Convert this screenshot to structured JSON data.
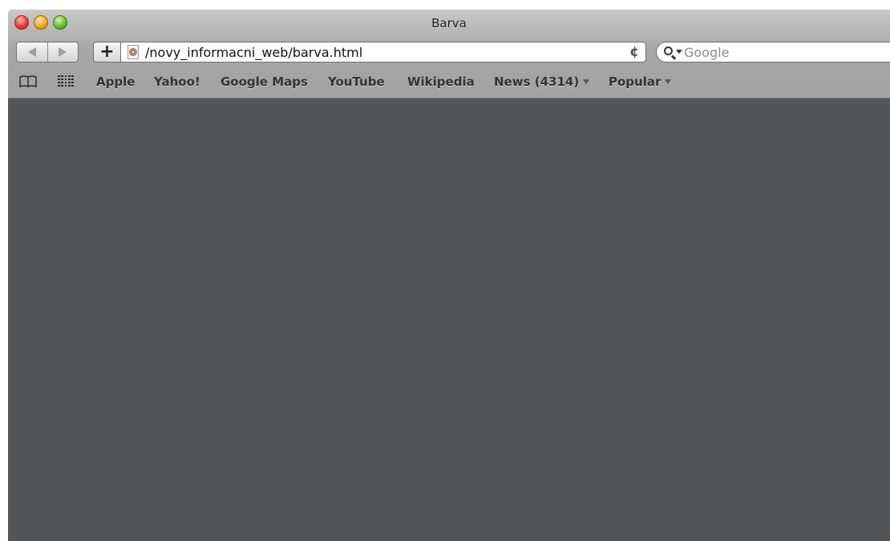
{
  "window": {
    "title": "Barva"
  },
  "toolbar": {
    "add_label": "+",
    "address": "/novy_informacni_web/barva.html",
    "reload_glyph": "¢",
    "search_placeholder": "Google"
  },
  "bookmarks": [
    {
      "label": "Apple",
      "menu": false
    },
    {
      "label": "Yahoo!",
      "menu": false
    },
    {
      "label": "Google Maps",
      "menu": false
    },
    {
      "label": "YouTube",
      "menu": false
    },
    {
      "label": "Wikipedia",
      "menu": false
    },
    {
      "label": "News (4314)",
      "menu": true
    },
    {
      "label": "Popular",
      "menu": true
    }
  ],
  "icons": {
    "window": [
      "close-icon",
      "minimize-icon",
      "zoom-icon"
    ],
    "navigation": [
      "back-icon",
      "forward-icon"
    ],
    "address": [
      "page-favicon-icon",
      "reload-icon"
    ],
    "search": [
      "search-icon"
    ],
    "bookmarks": [
      "book-icon",
      "grid-icon"
    ]
  },
  "colors": {
    "content_background": "#545559",
    "chrome_top": "#c9c9c9",
    "chrome_bottom": "#a2a2a2",
    "close": "#e0433a",
    "minimize": "#f2a82a",
    "zoom": "#69c036"
  }
}
